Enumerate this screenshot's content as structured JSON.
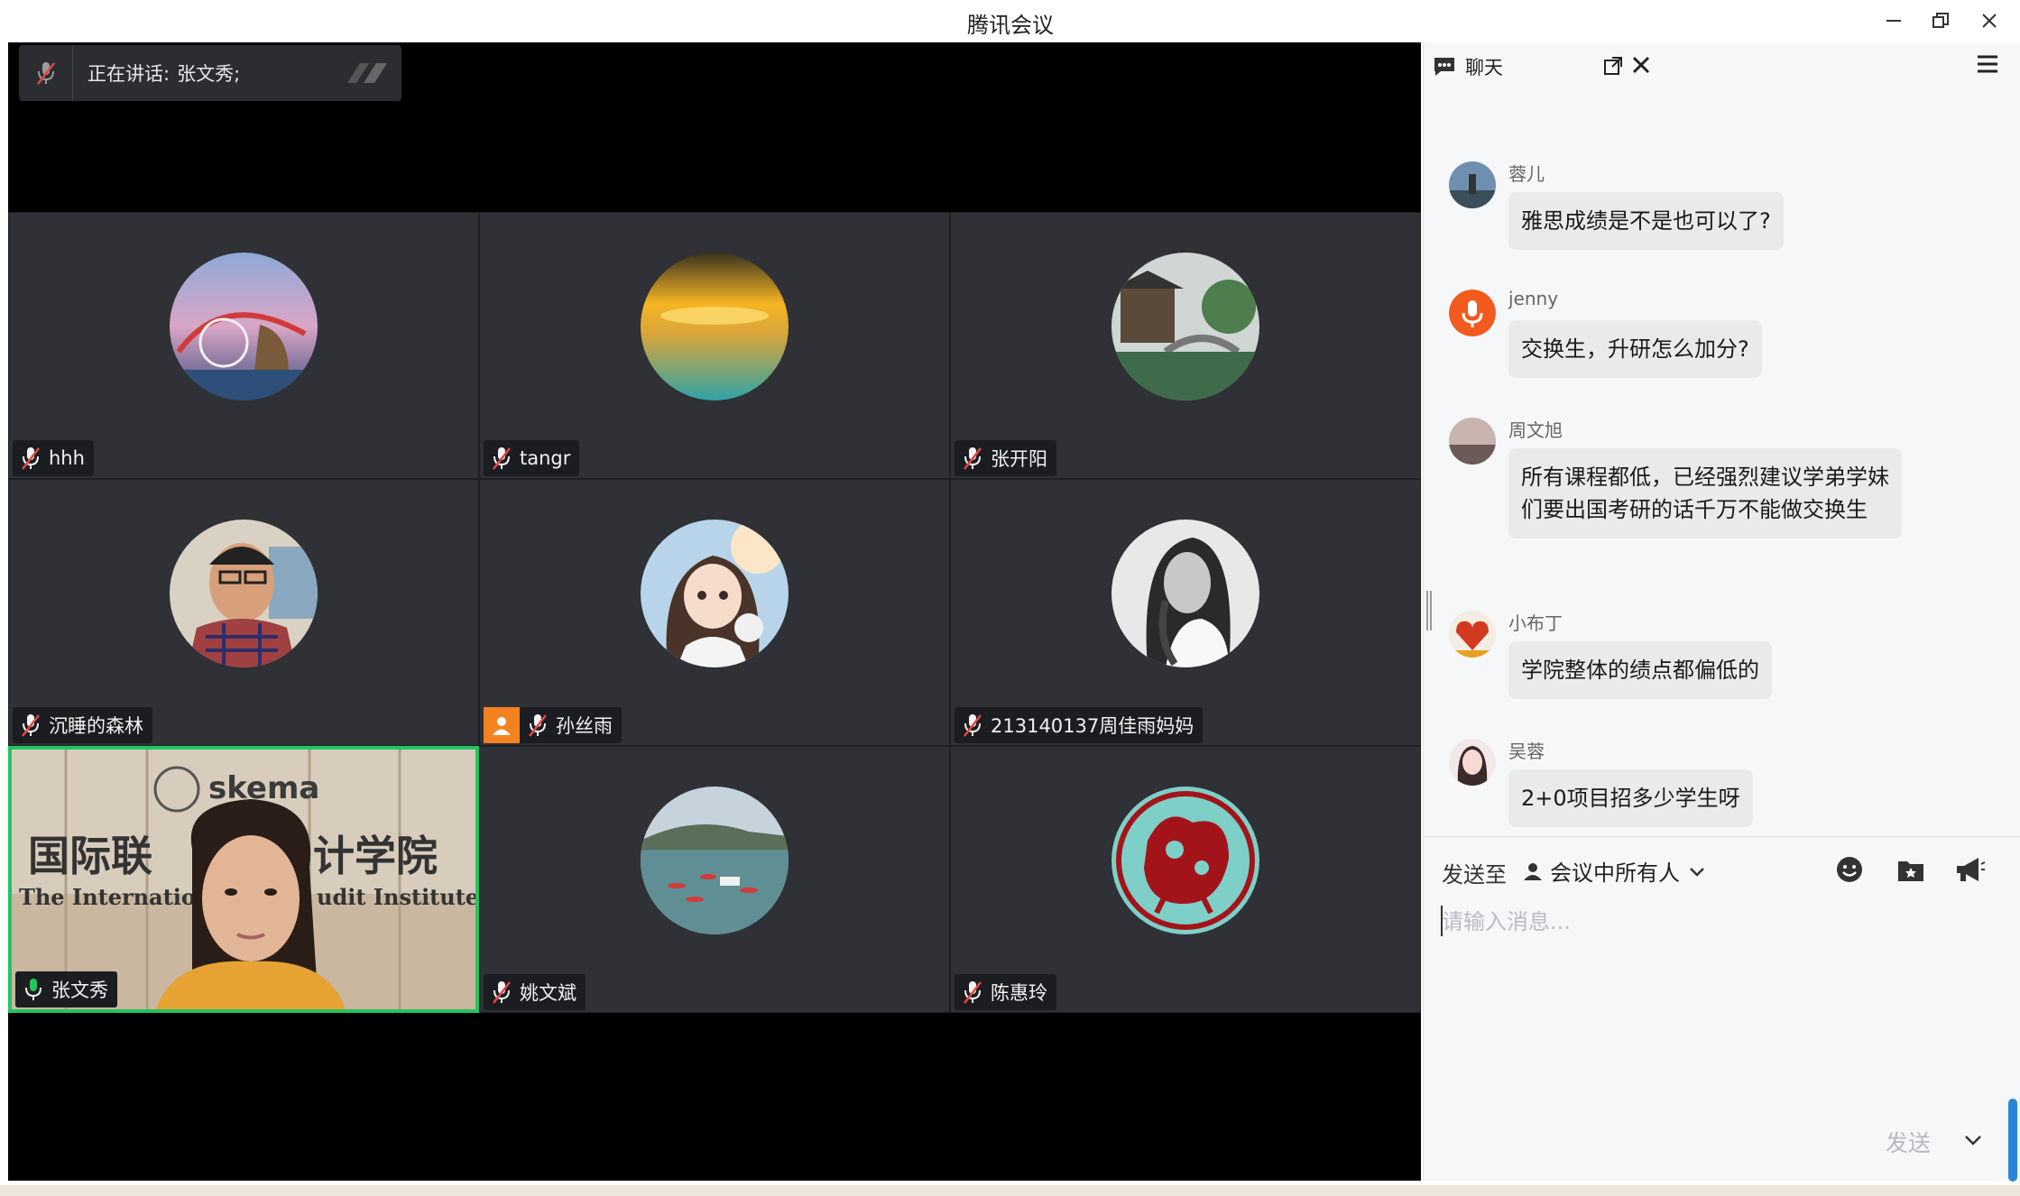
{
  "window": {
    "title": "腾讯会议",
    "minimize_icon": "minimize-icon",
    "maximize_icon": "restore-icon",
    "close_icon": "close-icon"
  },
  "speaking": {
    "label": "正在讲话:",
    "names": "张文秀;"
  },
  "participants": [
    {
      "name": "hhh",
      "muted": true
    },
    {
      "name": "tangr",
      "muted": true
    },
    {
      "name": "张开阳",
      "muted": true
    },
    {
      "name": "沉睡的森林",
      "muted": true
    },
    {
      "name": "孙丝雨",
      "muted": true,
      "camera_badge": true
    },
    {
      "name": "213140137周佳雨妈妈",
      "muted": true
    },
    {
      "name": "张文秀",
      "muted": false,
      "active": true
    },
    {
      "name": "姚文斌",
      "muted": true
    },
    {
      "name": "陈惠玲",
      "muted": true
    }
  ],
  "chat": {
    "tab_label": "聊天",
    "messages": [
      {
        "sender": "蓉儿",
        "text": "雅思成绩是不是也可以了?"
      },
      {
        "sender": "jenny",
        "text": "交换生，升研怎么加分?"
      },
      {
        "sender": "周文旭",
        "text": "所有课程都低，已经强烈建议学弟学妹们要出国考研的话千万不能做交换生"
      },
      {
        "sender": "小布丁",
        "text": "学院整体的绩点都偏低的"
      },
      {
        "sender": "吴蓉",
        "text": "2+0项目招多少学生呀"
      }
    ],
    "composer": {
      "send_to_label": "发送至",
      "recipient": "会议中所有人",
      "placeholder": "请输入消息...",
      "send_label": "发送"
    }
  },
  "colors": {
    "active_border": "#23c45e",
    "camera_badge": "#f58220",
    "tile_bg": "#2f3136",
    "scrollbar": "#2a86d8"
  }
}
